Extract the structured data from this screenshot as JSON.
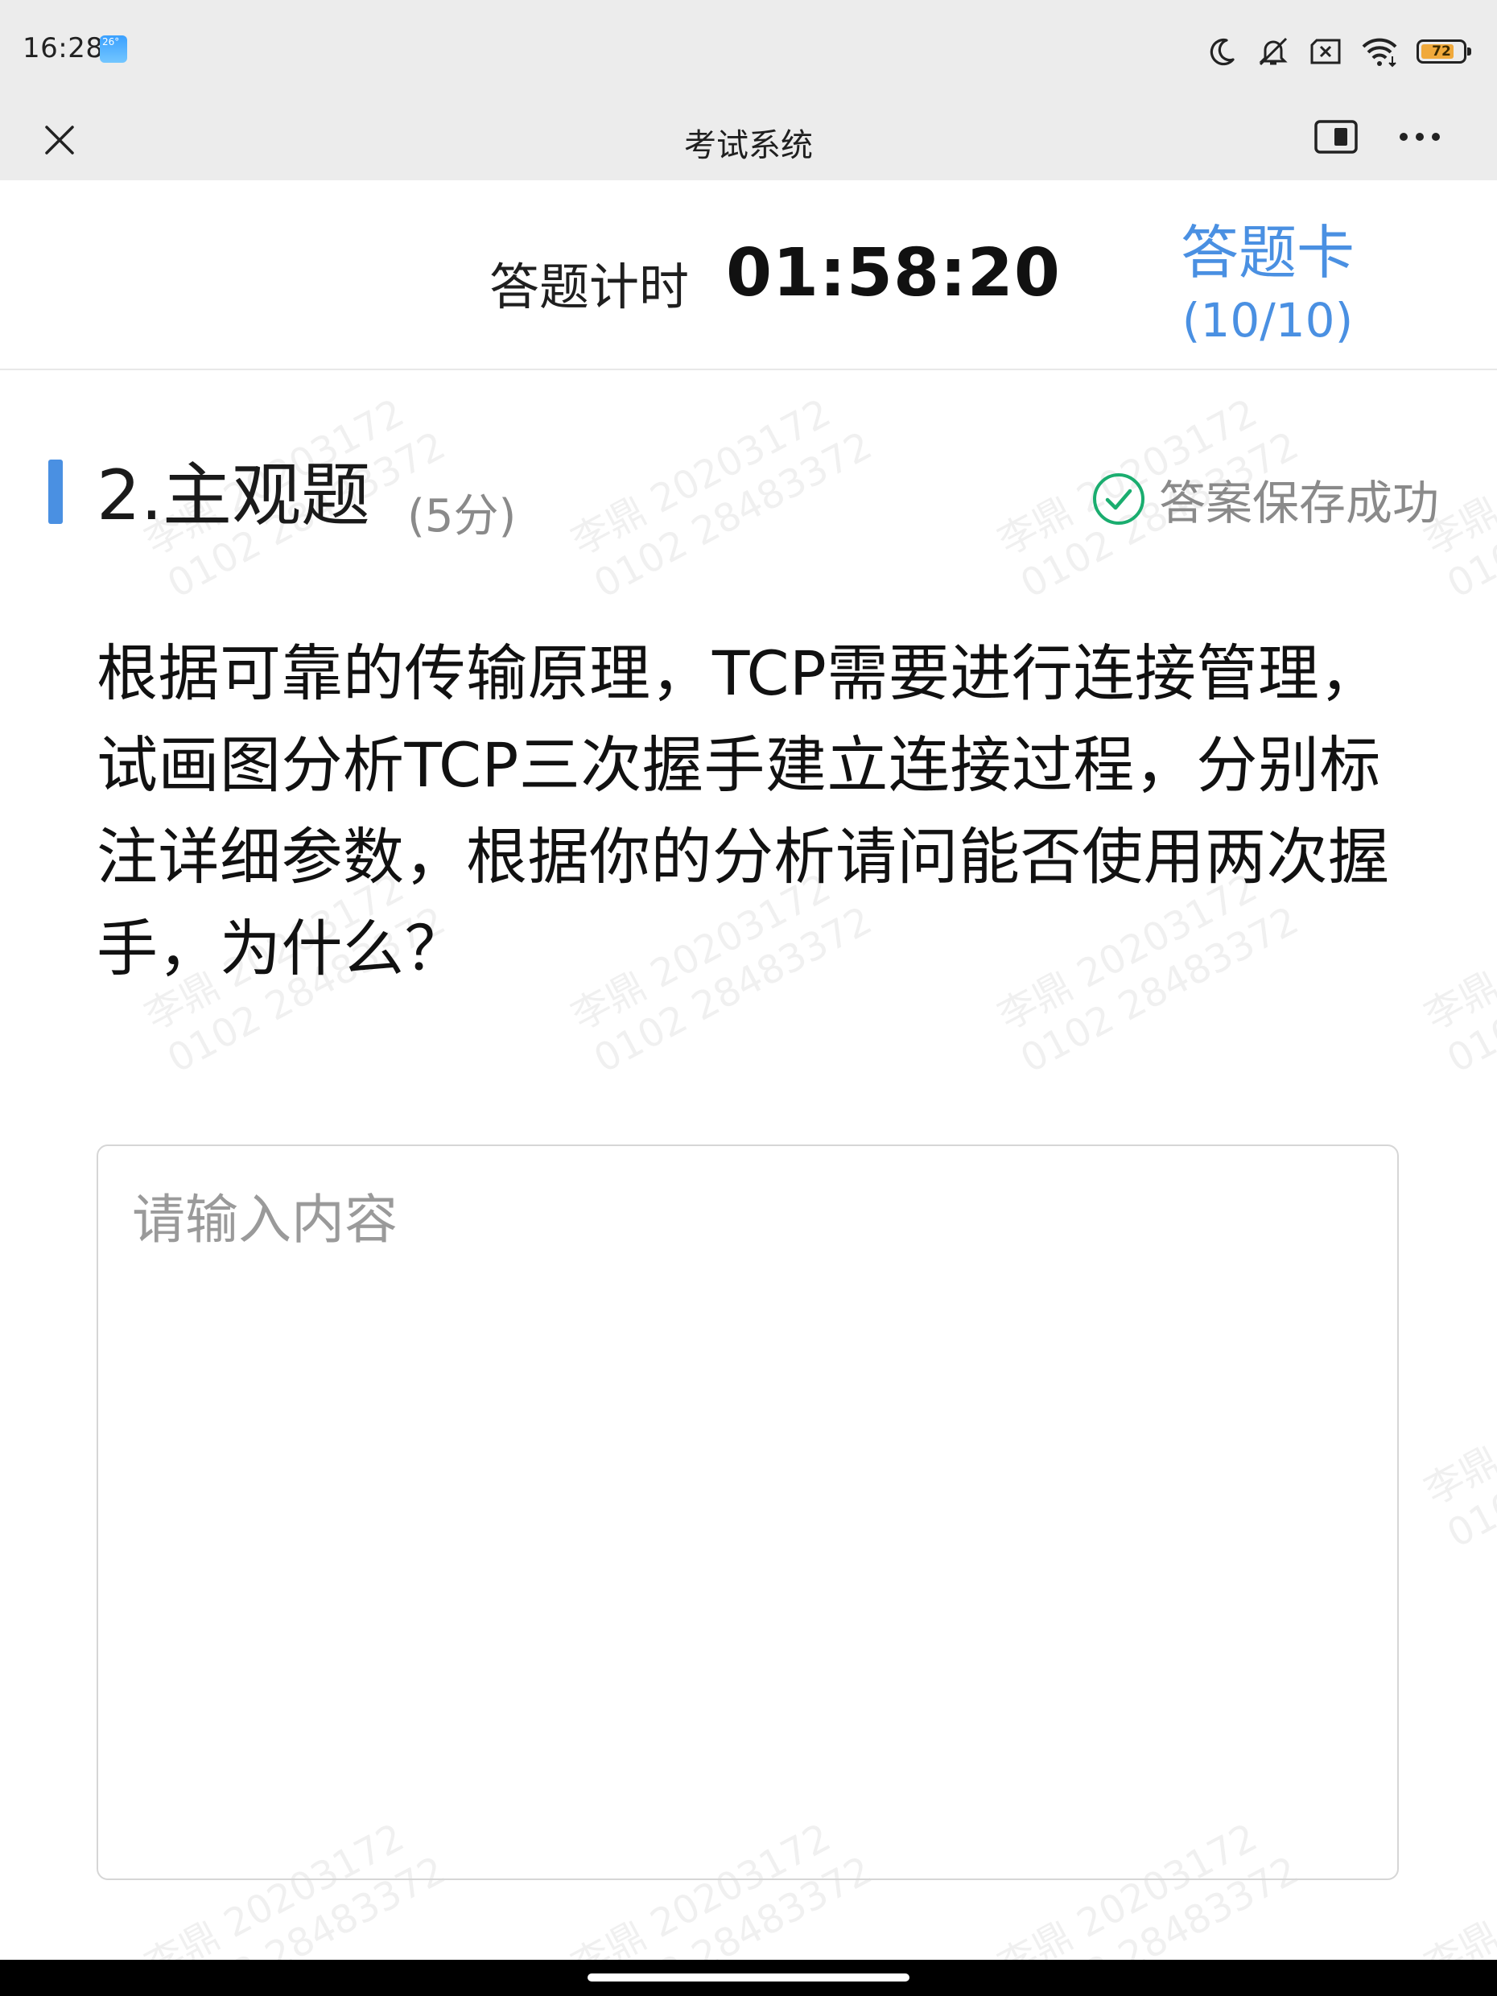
{
  "status_bar": {
    "time": "16:28",
    "weather_badge": "26°",
    "battery_level": "72",
    "icons": [
      "moon-icon",
      "silent-mode-icon",
      "sim-disabled-icon",
      "wifi-icon",
      "battery-icon"
    ]
  },
  "app_bar": {
    "title": "考试系统",
    "close_icon": "close-icon",
    "floating_window_icon": "floating-window-icon",
    "more_icon": "more-icon"
  },
  "timer": {
    "label": "答题计时",
    "value": "01:58:20"
  },
  "answer_card": {
    "label": "答题卡",
    "count": "(10/10)",
    "color": "#4a90e2"
  },
  "question": {
    "title": "2.主观题",
    "score": "(5分)",
    "save_status": "答案保存成功",
    "save_icon": "check-circle-icon",
    "save_color": "#1aad6f",
    "text": "根据可靠的传输原理，TCP需要进行连接管理，试画图分析TCP三次握手建立连接过程，分别标注详细参数，根据你的分析请问能否使用两次握手，为什么？",
    "accent_color": "#4a90e2"
  },
  "answer_input": {
    "placeholder": "请输入内容",
    "value": ""
  },
  "watermark": {
    "line1": "李鼎 20203172",
    "line2": "0102 28483372"
  }
}
